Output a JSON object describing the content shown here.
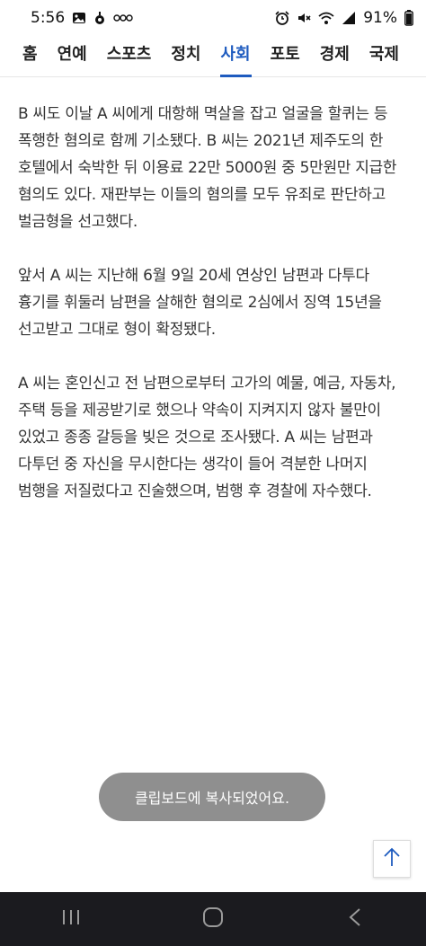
{
  "status_bar": {
    "time": "5:56",
    "battery": "91%",
    "left_icons": [
      "image-icon",
      "location-icon",
      "app-icon"
    ],
    "right_icons": [
      "alarm-icon",
      "mute-icon",
      "wifi-icon",
      "signal-icon",
      "battery-icon"
    ]
  },
  "nav": {
    "tabs": [
      {
        "label": "홈",
        "active": false
      },
      {
        "label": "연예",
        "active": false
      },
      {
        "label": "스포츠",
        "active": false
      },
      {
        "label": "정치",
        "active": false
      },
      {
        "label": "사회",
        "active": true
      },
      {
        "label": "포토",
        "active": false
      },
      {
        "label": "경제",
        "active": false
      },
      {
        "label": "국제",
        "active": false
      }
    ]
  },
  "article": {
    "paragraphs": [
      "B 씨도 이날 A 씨에게 대항해 멱살을 잡고 얼굴을 할퀴는 등 폭행한 혐의로 함께 기소됐다. B 씨는 2021년 제주도의 한 호텔에서 숙박한 뒤 이용료 22만 5000원 중 5만원만 지급한 혐의도 있다. 재판부는 이들의 혐의를 모두 유죄로 판단하고 벌금형을 선고했다.",
      "앞서 A 씨는 지난해 6월 9일 20세 연상인 남편과 다투다 흉기를 휘둘러 남편을 살해한 혐의로 2심에서 징역 15년을 선고받고 그대로 형이 확정됐다.",
      "A 씨는 혼인신고 전 남편으로부터 고가의 예물, 예금, 자동차, 주택 등을 제공받기로 했으나 약속이 지켜지지 않자 불만이 있었고 종종 갈등을 빚은 것으로 조사됐다. A 씨는 남편과 다투던 중 자신을 무시한다는 생각이 들어 격분한 나머지 범행을 저질렀다고 진술했으며, 범행 후 경찰에 자수했다."
    ]
  },
  "toast": {
    "message": "클립보드에 복사되었어요."
  },
  "scroll_top": {
    "icon": "arrow-up-icon"
  },
  "system_nav": {
    "icons": [
      "recent-apps-icon",
      "home-icon",
      "back-icon"
    ]
  },
  "colors": {
    "accent": "#1e5bbf",
    "toast_bg": "#8f8f8f",
    "nav_bar_bg": "#1b1b1f"
  }
}
